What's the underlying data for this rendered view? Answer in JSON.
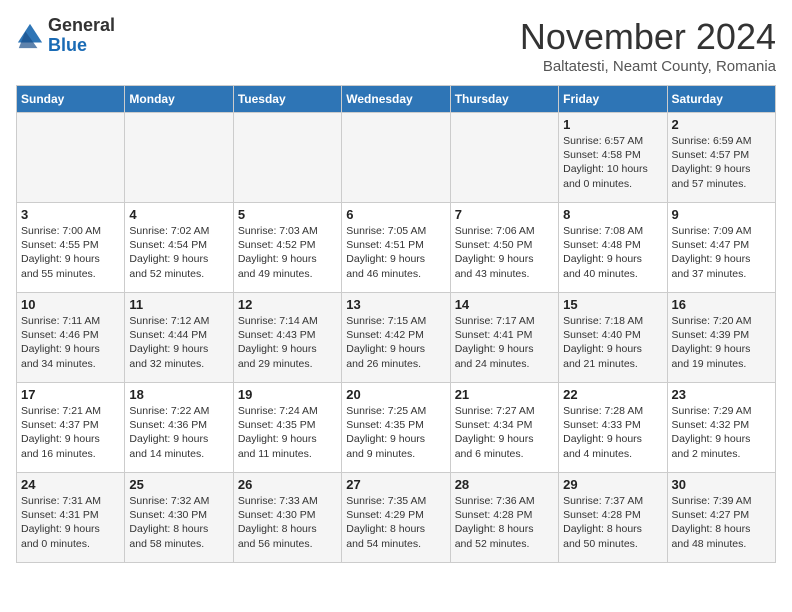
{
  "header": {
    "logo": {
      "general": "General",
      "blue": "Blue"
    },
    "title": "November 2024",
    "location": "Baltatesti, Neamt County, Romania"
  },
  "weekdays": [
    "Sunday",
    "Monday",
    "Tuesday",
    "Wednesday",
    "Thursday",
    "Friday",
    "Saturday"
  ],
  "weeks": [
    [
      {
        "day": "",
        "info": ""
      },
      {
        "day": "",
        "info": ""
      },
      {
        "day": "",
        "info": ""
      },
      {
        "day": "",
        "info": ""
      },
      {
        "day": "",
        "info": ""
      },
      {
        "day": "1",
        "info": "Sunrise: 6:57 AM\nSunset: 4:58 PM\nDaylight: 10 hours\nand 0 minutes."
      },
      {
        "day": "2",
        "info": "Sunrise: 6:59 AM\nSunset: 4:57 PM\nDaylight: 9 hours\nand 57 minutes."
      }
    ],
    [
      {
        "day": "3",
        "info": "Sunrise: 7:00 AM\nSunset: 4:55 PM\nDaylight: 9 hours\nand 55 minutes."
      },
      {
        "day": "4",
        "info": "Sunrise: 7:02 AM\nSunset: 4:54 PM\nDaylight: 9 hours\nand 52 minutes."
      },
      {
        "day": "5",
        "info": "Sunrise: 7:03 AM\nSunset: 4:52 PM\nDaylight: 9 hours\nand 49 minutes."
      },
      {
        "day": "6",
        "info": "Sunrise: 7:05 AM\nSunset: 4:51 PM\nDaylight: 9 hours\nand 46 minutes."
      },
      {
        "day": "7",
        "info": "Sunrise: 7:06 AM\nSunset: 4:50 PM\nDaylight: 9 hours\nand 43 minutes."
      },
      {
        "day": "8",
        "info": "Sunrise: 7:08 AM\nSunset: 4:48 PM\nDaylight: 9 hours\nand 40 minutes."
      },
      {
        "day": "9",
        "info": "Sunrise: 7:09 AM\nSunset: 4:47 PM\nDaylight: 9 hours\nand 37 minutes."
      }
    ],
    [
      {
        "day": "10",
        "info": "Sunrise: 7:11 AM\nSunset: 4:46 PM\nDaylight: 9 hours\nand 34 minutes."
      },
      {
        "day": "11",
        "info": "Sunrise: 7:12 AM\nSunset: 4:44 PM\nDaylight: 9 hours\nand 32 minutes."
      },
      {
        "day": "12",
        "info": "Sunrise: 7:14 AM\nSunset: 4:43 PM\nDaylight: 9 hours\nand 29 minutes."
      },
      {
        "day": "13",
        "info": "Sunrise: 7:15 AM\nSunset: 4:42 PM\nDaylight: 9 hours\nand 26 minutes."
      },
      {
        "day": "14",
        "info": "Sunrise: 7:17 AM\nSunset: 4:41 PM\nDaylight: 9 hours\nand 24 minutes."
      },
      {
        "day": "15",
        "info": "Sunrise: 7:18 AM\nSunset: 4:40 PM\nDaylight: 9 hours\nand 21 minutes."
      },
      {
        "day": "16",
        "info": "Sunrise: 7:20 AM\nSunset: 4:39 PM\nDaylight: 9 hours\nand 19 minutes."
      }
    ],
    [
      {
        "day": "17",
        "info": "Sunrise: 7:21 AM\nSunset: 4:37 PM\nDaylight: 9 hours\nand 16 minutes."
      },
      {
        "day": "18",
        "info": "Sunrise: 7:22 AM\nSunset: 4:36 PM\nDaylight: 9 hours\nand 14 minutes."
      },
      {
        "day": "19",
        "info": "Sunrise: 7:24 AM\nSunset: 4:35 PM\nDaylight: 9 hours\nand 11 minutes."
      },
      {
        "day": "20",
        "info": "Sunrise: 7:25 AM\nSunset: 4:35 PM\nDaylight: 9 hours\nand 9 minutes."
      },
      {
        "day": "21",
        "info": "Sunrise: 7:27 AM\nSunset: 4:34 PM\nDaylight: 9 hours\nand 6 minutes."
      },
      {
        "day": "22",
        "info": "Sunrise: 7:28 AM\nSunset: 4:33 PM\nDaylight: 9 hours\nand 4 minutes."
      },
      {
        "day": "23",
        "info": "Sunrise: 7:29 AM\nSunset: 4:32 PM\nDaylight: 9 hours\nand 2 minutes."
      }
    ],
    [
      {
        "day": "24",
        "info": "Sunrise: 7:31 AM\nSunset: 4:31 PM\nDaylight: 9 hours\nand 0 minutes."
      },
      {
        "day": "25",
        "info": "Sunrise: 7:32 AM\nSunset: 4:30 PM\nDaylight: 8 hours\nand 58 minutes."
      },
      {
        "day": "26",
        "info": "Sunrise: 7:33 AM\nSunset: 4:30 PM\nDaylight: 8 hours\nand 56 minutes."
      },
      {
        "day": "27",
        "info": "Sunrise: 7:35 AM\nSunset: 4:29 PM\nDaylight: 8 hours\nand 54 minutes."
      },
      {
        "day": "28",
        "info": "Sunrise: 7:36 AM\nSunset: 4:28 PM\nDaylight: 8 hours\nand 52 minutes."
      },
      {
        "day": "29",
        "info": "Sunrise: 7:37 AM\nSunset: 4:28 PM\nDaylight: 8 hours\nand 50 minutes."
      },
      {
        "day": "30",
        "info": "Sunrise: 7:39 AM\nSunset: 4:27 PM\nDaylight: 8 hours\nand 48 minutes."
      }
    ]
  ]
}
